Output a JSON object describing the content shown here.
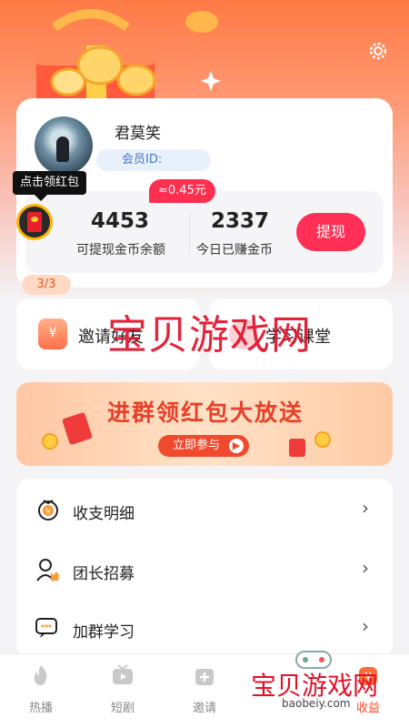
{
  "header": {
    "settings_icon": "gear-icon"
  },
  "profile": {
    "username": "君莫笑",
    "member_id_label": "会员ID:"
  },
  "stats": {
    "bonus_badge": "≈0.45元",
    "coins_balance": "4453",
    "coins_balance_label": "可提现金币余额",
    "today_coins": "2337",
    "today_coins_label": "今日已赚金币",
    "withdraw_label": "提现"
  },
  "redpacket": {
    "tooltip": "点击领红包",
    "counter": "3/3"
  },
  "actions": [
    {
      "label": "邀请好友",
      "icon": "yen-cup-icon"
    },
    {
      "label": "学习课堂",
      "icon": "heart-icon"
    }
  ],
  "watermark": "宝贝游戏网",
  "banner": {
    "title": "进群领红包大放送",
    "button_label": "立即参与"
  },
  "menu": [
    {
      "label": "收支明细",
      "icon": "yen-wallet-icon"
    },
    {
      "label": "团长招募",
      "icon": "user-crown-icon"
    },
    {
      "label": "加群学习",
      "icon": "chat-icon"
    }
  ],
  "tabs": [
    {
      "label": "热播",
      "icon": "flame-icon"
    },
    {
      "label": "短剧",
      "icon": "tv-icon"
    },
    {
      "label": "邀请",
      "icon": "gift-icon"
    },
    {
      "label": "收益",
      "icon": "yen-icon"
    }
  ],
  "logo": {
    "text": "宝贝游戏网",
    "url": "baobeiy.com"
  },
  "colors": {
    "accent": "#ff2f55",
    "brand_orange": "#ff7a45",
    "watermark": "#e0122a"
  }
}
